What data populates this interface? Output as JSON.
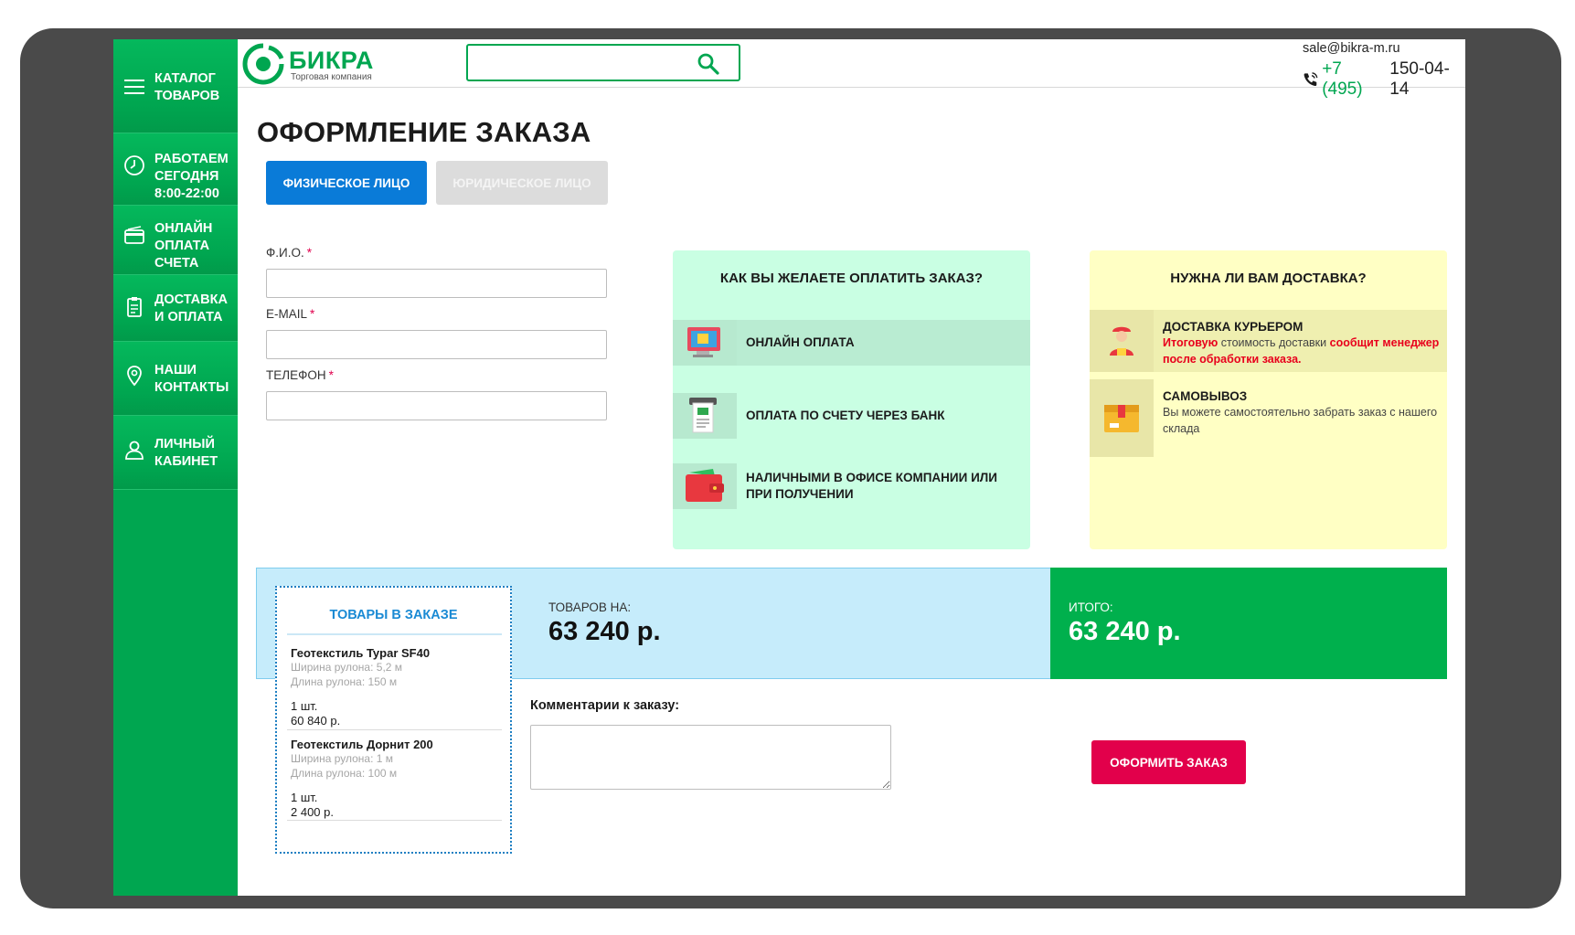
{
  "colors": {
    "brand_green": "#00a650",
    "accent_blue": "#0a7bd8",
    "submit_red": "#e2004b"
  },
  "sidebar": {
    "items": [
      {
        "label_lines": [
          "КАТАЛОГ",
          "ТОВАРОВ"
        ],
        "icon": "hamburger-icon"
      },
      {
        "label_lines": [
          "РАБОТАЕМ",
          "СЕГОДНЯ",
          "8:00-22:00"
        ],
        "icon": "clock-icon"
      },
      {
        "label_lines": [
          "ОНЛАЙН",
          "ОПЛАТА",
          "СЧЕТА"
        ],
        "icon": "credit-card-icon"
      },
      {
        "label_lines": [
          "ДОСТАВКА",
          "И ОПЛАТА"
        ],
        "icon": "clipboard-icon"
      },
      {
        "label_lines": [
          "НАШИ",
          "КОНТАКТЫ"
        ],
        "icon": "map-pin-icon"
      },
      {
        "label_lines": [
          "ЛИЧНЫЙ",
          "КАБИНЕТ"
        ],
        "icon": "user-icon"
      }
    ]
  },
  "header": {
    "logo_title": "БИКРА",
    "logo_subtitle": "Торговая компания",
    "search_placeholder": "",
    "email": "sale@bikra-m.ru",
    "phone_prefix": "+7 (495)",
    "phone_number": "150-04-14"
  },
  "main": {
    "title": "ОФОРМЛЕНИЕ ЗАКАЗА",
    "tabs": [
      {
        "label": "ФИЗИЧЕСКОЕ ЛИЦО",
        "active": true
      },
      {
        "label": "ЮРИДИЧЕСКОЕ ЛИЦО",
        "active": false
      }
    ],
    "form": {
      "fio_label": "Ф.И.О.",
      "email_label": "E-MAIL",
      "phone_label": "ТЕЛЕФОН",
      "required_mark": "*"
    }
  },
  "payment": {
    "title": "КАК ВЫ ЖЕЛАЕТЕ ОПЛАТИТЬ ЗАКАЗ?",
    "options": [
      {
        "label": "ОНЛАЙН ОПЛАТА",
        "icon": "online-payment-icon",
        "active": true
      },
      {
        "label": "ОПЛАТА ПО СЧЕТУ ЧЕРЕЗ БАНК",
        "icon": "bank-invoice-icon",
        "active": false
      },
      {
        "label": "НАЛИЧНЫМИ В ОФИСЕ КОМПАНИИ ИЛИ ПРИ ПОЛУЧЕНИИ",
        "icon": "wallet-icon",
        "active": false
      }
    ]
  },
  "delivery": {
    "title": "НУЖНА ЛИ ВАМ ДОСТАВКА?",
    "options": [
      {
        "title": "ДОСТАВКА КУРЬЕРОМ",
        "icon": "courier-icon",
        "desc_red_1": "Итоговую",
        "desc_plain": " стоимость доставки ",
        "desc_red_2": "сообщит менеджер после обработки заказа."
      },
      {
        "title": "САМОВЫВОЗ",
        "icon": "box-icon",
        "desc": "Вы можете самостоятельно забрать заказ с нашего склада"
      }
    ]
  },
  "summary": {
    "goods_label": "ТОВАРОВ НА:",
    "goods_value": "63 240 р.",
    "total_label": "ИТОГО:",
    "total_value": "63 240 р."
  },
  "cart": {
    "title": "ТОВАРЫ В ЗАКАЗЕ",
    "items": [
      {
        "name": "Геотекстиль Typar SF40",
        "width": "Ширина рулона: 5,2 м",
        "length": "Длина рулона: 150 м",
        "qty": "1 шт.",
        "price": "60 840 р."
      },
      {
        "name": "Геотекстиль Дорнит 200",
        "width": "Ширина рулона: 1 м",
        "length": "Длина рулона: 100 м",
        "qty": "1 шт.",
        "price": "2 400 р."
      }
    ]
  },
  "comment": {
    "label": "Комментарии к заказу:",
    "value": ""
  },
  "submit_label": "ОФОРМИТЬ ЗАКАЗ"
}
